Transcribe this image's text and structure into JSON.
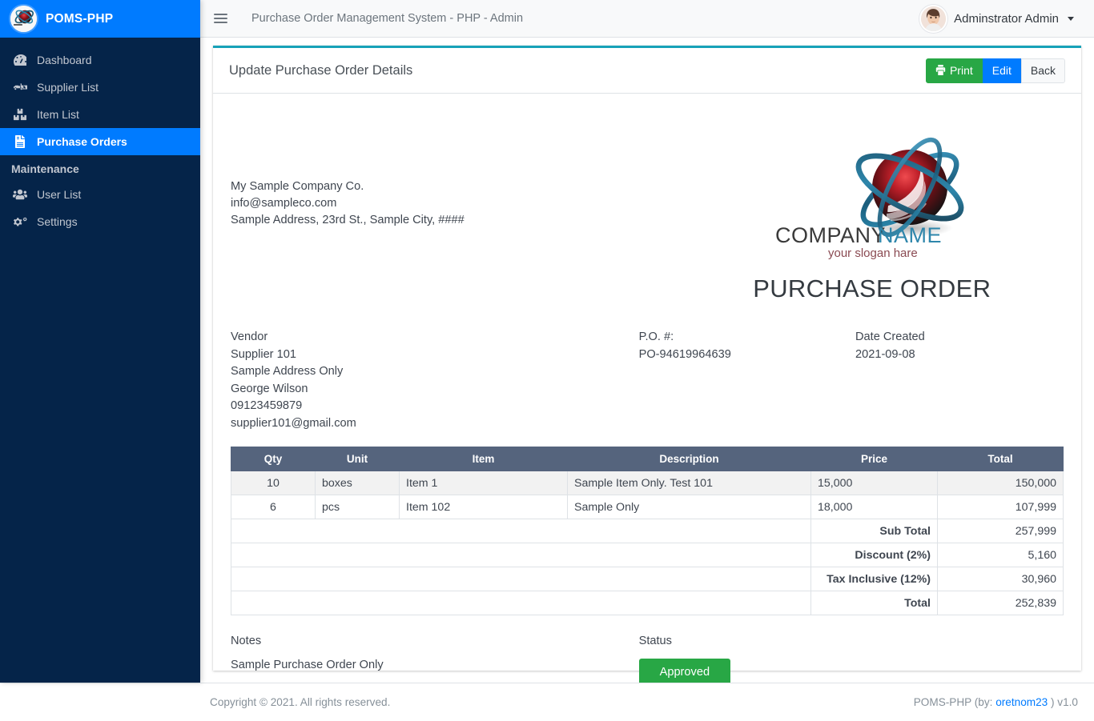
{
  "sidebar": {
    "brand": "POMS-PHP",
    "brand_logo_icon": "company-sphere-logo-icon",
    "items": [
      {
        "label": "Dashboard",
        "icon": "dashboard-gauge-icon",
        "active": false
      },
      {
        "label": "Supplier List",
        "icon": "truck-supplier-icon",
        "active": false
      },
      {
        "label": "Item List",
        "icon": "boxes-item-icon",
        "active": false
      },
      {
        "label": "Purchase Orders",
        "icon": "file-invoice-icon",
        "active": true
      }
    ],
    "section_header": "Maintenance",
    "maintenance_items": [
      {
        "label": "User List",
        "icon": "users-group-icon",
        "active": false
      },
      {
        "label": "Settings",
        "icon": "gears-settings-icon",
        "active": false
      }
    ]
  },
  "topbar": {
    "menu_icon": "hamburger-menu-icon",
    "title": "Purchase Order Management System - PHP - Admin",
    "user_name": "Adminstrator Admin",
    "avatar_icon": "user-avatar-icon",
    "caret_icon": "caret-down-icon"
  },
  "card": {
    "title": "Update Purchase Order Details",
    "accent_color": "#17a2b8",
    "buttons": {
      "print": {
        "label": "Print",
        "icon": "printer-icon",
        "color": "#28a745"
      },
      "edit": {
        "label": "Edit",
        "color": "#007bff"
      },
      "back": {
        "label": "Back",
        "color": "#f8f9fa"
      }
    }
  },
  "company": {
    "name": "My Sample Company Co.",
    "email": "info@sampleco.com",
    "address": "Sample Address, 23rd St., Sample City, ####"
  },
  "logo": {
    "icon": "company-name-sphere-logo-icon",
    "text": "COMPANY NAME",
    "slogan": "your slogan hare"
  },
  "document": {
    "heading": "PURCHASE ORDER"
  },
  "vendor": {
    "label": "Vendor",
    "name": "Supplier 101",
    "address": "Sample Address Only",
    "contact_person": "George Wilson",
    "phone": "09123459879",
    "email": "supplier101@gmail.com"
  },
  "po": {
    "label": "P.O. #:",
    "number": "PO-94619964639"
  },
  "date": {
    "label": "Date Created",
    "value": "2021-09-08"
  },
  "items_table": {
    "headers": [
      "Qty",
      "Unit",
      "Item",
      "Description",
      "Price",
      "Total"
    ],
    "rows": [
      {
        "qty": "10",
        "unit": "boxes",
        "item": "Item 1",
        "description": "Sample Item Only. Test 101",
        "price": "15,000",
        "total": "150,000"
      },
      {
        "qty": "6",
        "unit": "pcs",
        "item": "Item 102",
        "description": "Sample Only",
        "price": "18,000",
        "total": "107,999"
      }
    ],
    "summary": [
      {
        "label": "Sub Total",
        "value": "257,999"
      },
      {
        "label": "Discount (2%)",
        "value": "5,160"
      },
      {
        "label": "Tax Inclusive (12%)",
        "value": "30,960"
      },
      {
        "label": "Total",
        "value": "252,839"
      }
    ]
  },
  "notes": {
    "label": "Notes",
    "text": "Sample Purchase Order Only"
  },
  "status": {
    "label": "Status",
    "value": "Approved",
    "color": "#28a745"
  },
  "footer": {
    "copyright": "Copyright © 2021. All rights reserved.",
    "brand_prefix": "POMS-PHP (by: ",
    "author": "oretnom23",
    "brand_suffix": " ) v1.0"
  }
}
